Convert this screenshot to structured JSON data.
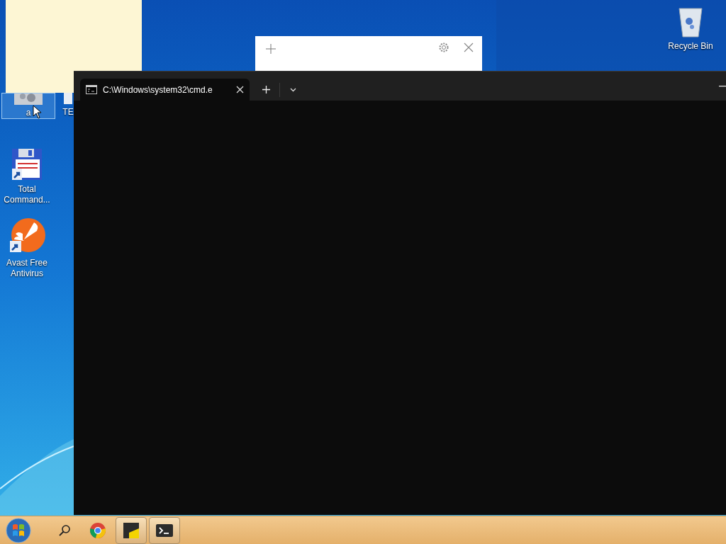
{
  "desktop_icons": [
    {
      "kind": "gear",
      "label": "a",
      "selected": true
    },
    {
      "kind": "document",
      "label": "TE",
      "selected": false
    },
    {
      "kind": "floppy",
      "label": "Total Command...",
      "selected": false
    },
    {
      "kind": "avast",
      "label": "Avast Free Antivirus",
      "selected": false
    },
    {
      "kind": "recycle",
      "label": "Recycle Bin",
      "selected": false
    }
  ],
  "terminal": {
    "tabs": [
      {
        "title": "C:\\Windows\\system32\\cmd.e",
        "selected": true
      }
    ]
  },
  "taskbar": {
    "items": [
      {
        "kind": "search",
        "open": false
      },
      {
        "kind": "chrome",
        "open": false
      },
      {
        "kind": "sticky",
        "open": true
      },
      {
        "kind": "terminal",
        "open": true
      }
    ]
  }
}
